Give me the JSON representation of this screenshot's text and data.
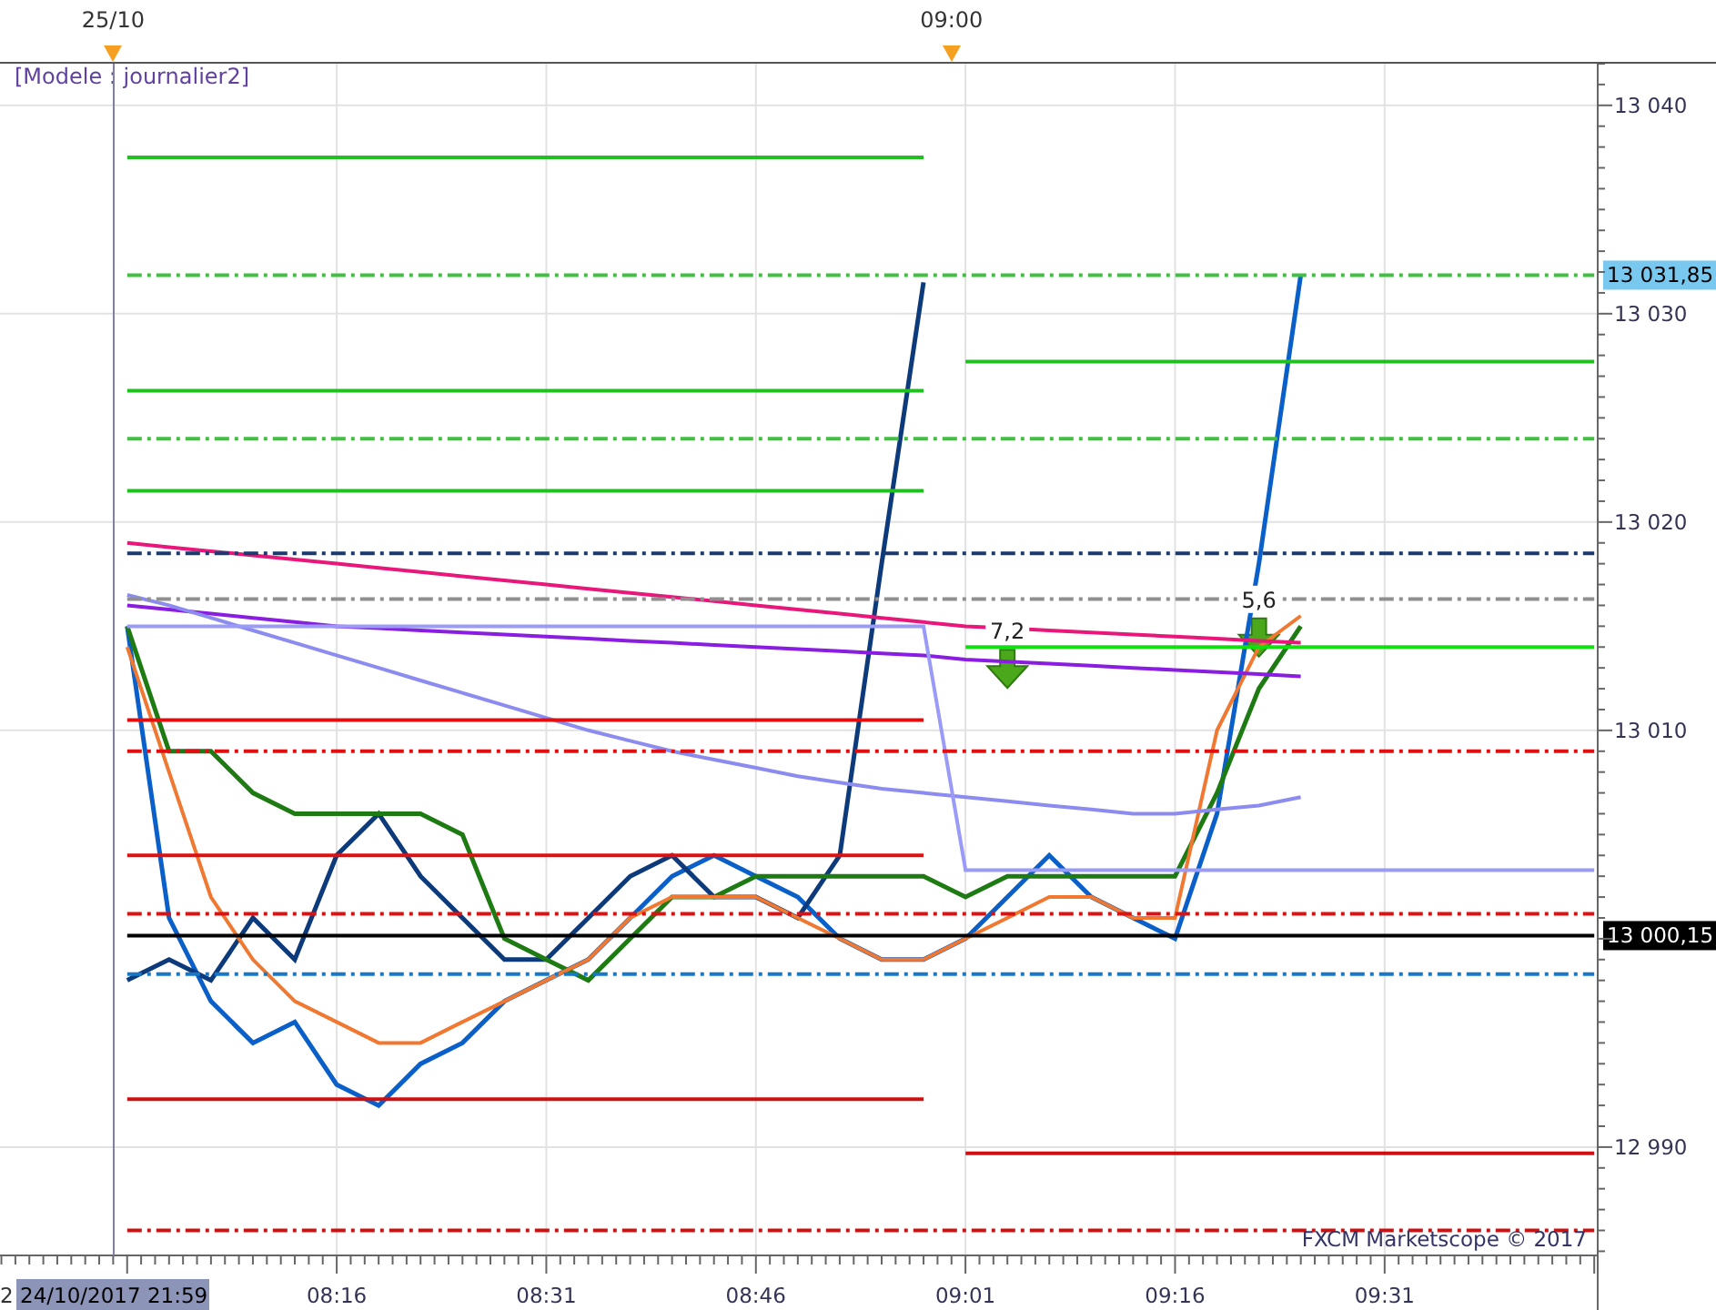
{
  "chart": {
    "time_markers": [
      {
        "label": "25/10"
      },
      {
        "label": "09:00"
      }
    ],
    "model_label": "[Modele : journalier2]",
    "credit": "FXCM Marketscope © 2017",
    "cursor_cut": "2",
    "cursor_label": "24/10/2017 21:59",
    "chart_data": {
      "type": "line",
      "grid": true,
      "xlim": [
        471.9,
        586.25
      ],
      "ylim": [
        12984.8,
        13042
      ],
      "x": [
        481,
        484,
        487,
        490,
        493,
        496,
        499,
        502,
        505,
        508,
        511,
        514,
        517,
        520,
        523,
        526,
        529,
        532,
        535,
        538,
        541,
        544,
        547,
        550,
        553,
        556,
        559,
        562,
        565,
        568,
        571,
        574,
        577,
        580,
        583,
        586
      ],
      "xticks": [
        {
          "value": 496,
          "label": "08:16"
        },
        {
          "value": 511,
          "label": "08:31"
        },
        {
          "value": 526,
          "label": "08:46"
        },
        {
          "value": 541,
          "label": "09:01"
        },
        {
          "value": 556,
          "label": "09:16"
        },
        {
          "value": 571,
          "label": "09:31"
        }
      ],
      "yticks": [
        {
          "value": 12990,
          "label": "12 990"
        },
        {
          "value": 13010,
          "label": "13 010"
        },
        {
          "value": 13020,
          "label": "13 020"
        },
        {
          "value": 13030,
          "label": "13 030"
        },
        {
          "value": 13040,
          "label": "13 040"
        }
      ],
      "series": [
        {
          "color": "#0a5fc8",
          "values": [
            13015,
            13001,
            12997,
            12995,
            12996,
            12993,
            12992,
            12994,
            12995,
            12997,
            12998,
            12999,
            13001,
            13003,
            13004,
            13003,
            13002,
            13000,
            12999,
            12999,
            13000,
            13002,
            13004,
            13002,
            13001,
            13000,
            13006,
            13018,
            13031.85,
            null,
            null,
            null,
            null,
            null,
            null,
            null
          ]
        },
        {
          "color": "#0d3a7a",
          "values": [
            12998,
            12999,
            12998,
            13001,
            12999,
            13004,
            13006,
            13003,
            13001,
            12999,
            12999,
            13001,
            13003,
            13004,
            13002,
            13002,
            13001,
            13004,
            13018,
            13031.5,
            null,
            null,
            null,
            null,
            null,
            null,
            null,
            null,
            null,
            null,
            null,
            null,
            null,
            null,
            null,
            null
          ]
        },
        {
          "color": "#1e7a12",
          "values": [
            13015,
            13009,
            13009,
            13007,
            13006,
            13006,
            13006,
            13006,
            13005,
            13000,
            12999,
            12998,
            13000,
            13002,
            13002,
            13003,
            13003,
            13003,
            13003,
            13003,
            13002,
            13003,
            13003,
            13003,
            13003,
            13003,
            13007,
            13012,
            13015,
            null,
            null,
            null,
            null,
            null,
            null,
            null
          ]
        },
        {
          "color": "#f07830",
          "values": [
            13014,
            13008,
            13002,
            12999,
            12997,
            12996,
            12995,
            12995,
            12996,
            12997,
            12998,
            12999,
            13001,
            13002,
            13002,
            13002,
            13001,
            13000,
            12999,
            12999,
            13000,
            13001,
            13002,
            13002,
            13001,
            13001,
            13010,
            13014,
            13015.5,
            null,
            null,
            null,
            null,
            null,
            null,
            null
          ]
        },
        {
          "color": "#e8187a",
          "values": [
            13019,
            13018.8,
            13018.6,
            13018.4,
            13018.2,
            13018,
            13017.8,
            13017.6,
            13017.4,
            13017.2,
            13017,
            13016.8,
            13016.6,
            13016.4,
            13016.2,
            13016,
            13015.8,
            13015.6,
            13015.4,
            13015.2,
            13015,
            13014.9,
            13014.8,
            13014.7,
            13014.6,
            13014.5,
            13014.4,
            13014.3,
            13014.2,
            null,
            null,
            null,
            null,
            null,
            null,
            null
          ]
        },
        {
          "color": "#8a1ee0",
          "values": [
            13016,
            13015.8,
            13015.6,
            13015.4,
            13015.2,
            13015,
            13014.9,
            13014.8,
            13014.7,
            13014.6,
            13014.5,
            13014.4,
            13014.3,
            13014.2,
            13014.1,
            13014,
            13013.9,
            13013.8,
            13013.7,
            13013.6,
            13013.4,
            13013.3,
            13013.2,
            13013.1,
            13013,
            13012.9,
            13012.8,
            13012.7,
            13012.6,
            null,
            null,
            null,
            null,
            null,
            null,
            null
          ]
        },
        {
          "color": "#8c8cf0",
          "values": [
            13016.5,
            13016,
            13015.4,
            13014.8,
            13014.2,
            13013.6,
            13013,
            13012.4,
            13011.8,
            13011.2,
            13010.6,
            13010,
            13009.5,
            13009,
            13008.6,
            13008.2,
            13007.8,
            13007.5,
            13007.2,
            13007,
            13006.8,
            13006.6,
            13006.4,
            13006.2,
            13006,
            13006,
            13006.2,
            13006.4,
            13006.8,
            null,
            null,
            null,
            null,
            null,
            null,
            null
          ]
        },
        {
          "color": "#9a9af8",
          "values": [
            13015,
            13015,
            13015,
            13015,
            13015,
            13015,
            13015,
            13015,
            13015,
            13015,
            13015,
            13015,
            13015,
            13015,
            13015,
            13015,
            13015,
            13015,
            13015,
            13015,
            13003.3,
            13003.3,
            13003.3,
            13003.3,
            13003.3,
            13003.3,
            13003.3,
            13003.3,
            13003.3,
            13003.3,
            13003.3,
            13003.3,
            13003.3,
            13003.3,
            13003.3,
            13003.3
          ]
        },
        {
          "color": "#20c020",
          "values": [
            13037.5,
            13037.5,
            13037.5,
            13037.5,
            13037.5,
            13037.5,
            13037.5,
            13037.5,
            13037.5,
            13037.5,
            13037.5,
            13037.5,
            13037.5,
            13037.5,
            13037.5,
            13037.5,
            13037.5,
            13037.5,
            13037.5,
            13037.5,
            null,
            null,
            null,
            null,
            null,
            null,
            null,
            null,
            null,
            null,
            null,
            null,
            null,
            null,
            null,
            null
          ]
        },
        {
          "color": "#20c020",
          "values": [
            13026.3,
            13026.3,
            13026.3,
            13026.3,
            13026.3,
            13026.3,
            13026.3,
            13026.3,
            13026.3,
            13026.3,
            13026.3,
            13026.3,
            13026.3,
            13026.3,
            13026.3,
            13026.3,
            13026.3,
            13026.3,
            13026.3,
            13026.3,
            null,
            null,
            null,
            null,
            null,
            null,
            null,
            null,
            null,
            null,
            null,
            null,
            null,
            null,
            null,
            null
          ]
        },
        {
          "color": "#20c020",
          "values": [
            13021.5,
            13021.5,
            13021.5,
            13021.5,
            13021.5,
            13021.5,
            13021.5,
            13021.5,
            13021.5,
            13021.5,
            13021.5,
            13021.5,
            13021.5,
            13021.5,
            13021.5,
            13021.5,
            13021.5,
            13021.5,
            13021.5,
            13021.5,
            null,
            null,
            null,
            null,
            null,
            null,
            null,
            null,
            null,
            null,
            null,
            null,
            null,
            null,
            null,
            null
          ]
        },
        {
          "color": "#e01010",
          "values": [
            13010.5,
            13010.5,
            13010.5,
            13010.5,
            13010.5,
            13010.5,
            13010.5,
            13010.5,
            13010.5,
            13010.5,
            13010.5,
            13010.5,
            13010.5,
            13010.5,
            13010.5,
            13010.5,
            13010.5,
            13010.5,
            13010.5,
            13010.5,
            null,
            null,
            null,
            null,
            null,
            null,
            null,
            null,
            null,
            null,
            null,
            null,
            null,
            null,
            null,
            null
          ]
        },
        {
          "color": "#e01010",
          "values": [
            13004,
            13004,
            13004,
            13004,
            13004,
            13004,
            13004,
            13004,
            13004,
            13004,
            13004,
            13004,
            13004,
            13004,
            13004,
            13004,
            13004,
            13004,
            13004,
            13004,
            null,
            null,
            null,
            null,
            null,
            null,
            null,
            null,
            null,
            null,
            null,
            null,
            null,
            null,
            null,
            null
          ]
        },
        {
          "color": "#d01010",
          "values": [
            12992.3,
            12992.3,
            12992.3,
            12992.3,
            12992.3,
            12992.3,
            12992.3,
            12992.3,
            12992.3,
            12992.3,
            12992.3,
            12992.3,
            12992.3,
            12992.3,
            12992.3,
            12992.3,
            12992.3,
            12992.3,
            12992.3,
            12992.3,
            null,
            null,
            null,
            null,
            null,
            null,
            null,
            null,
            null,
            null,
            null,
            null,
            null,
            null,
            null,
            null
          ]
        },
        {
          "color": "#20c020",
          "values": [
            null,
            null,
            null,
            null,
            null,
            null,
            null,
            null,
            null,
            null,
            null,
            null,
            null,
            null,
            null,
            null,
            null,
            null,
            null,
            null,
            13027.7,
            13027.7,
            13027.7,
            13027.7,
            13027.7,
            13027.7,
            13027.7,
            13027.7,
            13027.7,
            13027.7,
            13027.7,
            13027.7,
            13027.7,
            13027.7,
            13027.7,
            13027.7
          ]
        },
        {
          "color": "#10e010",
          "values": [
            null,
            null,
            null,
            null,
            null,
            null,
            null,
            null,
            null,
            null,
            null,
            null,
            null,
            null,
            null,
            null,
            null,
            null,
            null,
            null,
            13014,
            13014,
            13014,
            13014,
            13014,
            13014,
            13014,
            13014,
            13014,
            13014,
            13014,
            13014,
            13014,
            13014,
            13014,
            13014
          ]
        },
        {
          "color": "#d01010",
          "values": [
            null,
            null,
            null,
            null,
            null,
            null,
            null,
            null,
            null,
            null,
            null,
            null,
            null,
            null,
            null,
            null,
            null,
            null,
            null,
            null,
            12989.7,
            12989.7,
            12989.7,
            12989.7,
            12989.7,
            12989.7,
            12989.7,
            12989.7,
            12989.7,
            12989.7,
            12989.7,
            12989.7,
            12989.7,
            12989.7,
            12989.7,
            12989.7
          ]
        },
        {
          "name": "13 000,15",
          "color": "#000000",
          "values": [
            13000.15,
            13000.15,
            13000.15,
            13000.15,
            13000.15,
            13000.15,
            13000.15,
            13000.15,
            13000.15,
            13000.15,
            13000.15,
            13000.15,
            13000.15,
            13000.15,
            13000.15,
            13000.15,
            13000.15,
            13000.15,
            13000.15,
            13000.15,
            13000.15,
            13000.15,
            13000.15,
            13000.15,
            13000.15,
            13000.15,
            13000.15,
            13000.15,
            13000.15,
            13000.15,
            13000.15,
            13000.15,
            13000.15,
            13000.15,
            13000.15,
            13000.15
          ]
        },
        {
          "name": "13 031,85",
          "color": "#40c040",
          "line_style": "dashed",
          "values": [
            13031.85,
            13031.85,
            13031.85,
            13031.85,
            13031.85,
            13031.85,
            13031.85,
            13031.85,
            13031.85,
            13031.85,
            13031.85,
            13031.85,
            13031.85,
            13031.85,
            13031.85,
            13031.85,
            13031.85,
            13031.85,
            13031.85,
            13031.85,
            13031.85,
            13031.85,
            13031.85,
            13031.85,
            13031.85,
            13031.85,
            13031.85,
            13031.85,
            13031.85,
            13031.85,
            13031.85,
            13031.85,
            13031.85,
            13031.85,
            13031.85,
            13031.85
          ]
        },
        {
          "color": "#40c040",
          "line_style": "dashed",
          "values": [
            13024,
            13024,
            13024,
            13024,
            13024,
            13024,
            13024,
            13024,
            13024,
            13024,
            13024,
            13024,
            13024,
            13024,
            13024,
            13024,
            13024,
            13024,
            13024,
            13024,
            13024,
            13024,
            13024,
            13024,
            13024,
            13024,
            13024,
            13024,
            13024,
            13024,
            13024,
            13024,
            13024,
            13024,
            13024,
            13024
          ]
        },
        {
          "color": "#1a3a70",
          "line_style": "dashed",
          "values": [
            13018.5,
            13018.5,
            13018.5,
            13018.5,
            13018.5,
            13018.5,
            13018.5,
            13018.5,
            13018.5,
            13018.5,
            13018.5,
            13018.5,
            13018.5,
            13018.5,
            13018.5,
            13018.5,
            13018.5,
            13018.5,
            13018.5,
            13018.5,
            13018.5,
            13018.5,
            13018.5,
            13018.5,
            13018.5,
            13018.5,
            13018.5,
            13018.5,
            13018.5,
            13018.5,
            13018.5,
            13018.5,
            13018.5,
            13018.5,
            13018.5,
            13018.5
          ]
        },
        {
          "color": "#909090",
          "line_style": "dashed",
          "values": [
            13016.3,
            13016.3,
            13016.3,
            13016.3,
            13016.3,
            13016.3,
            13016.3,
            13016.3,
            13016.3,
            13016.3,
            13016.3,
            13016.3,
            13016.3,
            13016.3,
            13016.3,
            13016.3,
            13016.3,
            13016.3,
            13016.3,
            13016.3,
            13016.3,
            13016.3,
            13016.3,
            13016.3,
            13016.3,
            13016.3,
            13016.3,
            13016.3,
            13016.3,
            13016.3,
            13016.3,
            13016.3,
            13016.3,
            13016.3,
            13016.3,
            13016.3
          ]
        },
        {
          "color": "#e01010",
          "line_style": "dashed",
          "values": [
            13009,
            13009,
            13009,
            13009,
            13009,
            13009,
            13009,
            13009,
            13009,
            13009,
            13009,
            13009,
            13009,
            13009,
            13009,
            13009,
            13009,
            13009,
            13009,
            13009,
            13009,
            13009,
            13009,
            13009,
            13009,
            13009,
            13009,
            13009,
            13009,
            13009,
            13009,
            13009,
            13009,
            13009,
            13009,
            13009
          ]
        },
        {
          "color": "#e01010",
          "line_style": "dashed",
          "values": [
            13001.2,
            13001.2,
            13001.2,
            13001.2,
            13001.2,
            13001.2,
            13001.2,
            13001.2,
            13001.2,
            13001.2,
            13001.2,
            13001.2,
            13001.2,
            13001.2,
            13001.2,
            13001.2,
            13001.2,
            13001.2,
            13001.2,
            13001.2,
            13001.2,
            13001.2,
            13001.2,
            13001.2,
            13001.2,
            13001.2,
            13001.2,
            13001.2,
            13001.2,
            13001.2,
            13001.2,
            13001.2,
            13001.2,
            13001.2,
            13001.2,
            13001.2
          ]
        },
        {
          "color": "#1878c8",
          "line_style": "dashed",
          "values": [
            12998.3,
            12998.3,
            12998.3,
            12998.3,
            12998.3,
            12998.3,
            12998.3,
            12998.3,
            12998.3,
            12998.3,
            12998.3,
            12998.3,
            12998.3,
            12998.3,
            12998.3,
            12998.3,
            12998.3,
            12998.3,
            12998.3,
            12998.3,
            12998.3,
            12998.3,
            12998.3,
            12998.3,
            12998.3,
            12998.3,
            12998.3,
            12998.3,
            12998.3,
            12998.3,
            12998.3,
            12998.3,
            12998.3,
            12998.3,
            12998.3,
            12998.3
          ]
        },
        {
          "color": "#d01010",
          "line_style": "dashed",
          "values": [
            12986,
            12986,
            12986,
            12986,
            12986,
            12986,
            12986,
            12986,
            12986,
            12986,
            12986,
            12986,
            12986,
            12986,
            12986,
            12986,
            12986,
            12986,
            12986,
            12986,
            12986,
            12986,
            12986,
            12986,
            12986,
            12986,
            12986,
            12986,
            12986,
            12986,
            12986,
            12986,
            12986,
            12986,
            12986,
            12986
          ]
        }
      ],
      "annotations": [
        {
          "x": 544,
          "y": 13013,
          "text": "7,2"
        },
        {
          "x": 562,
          "y": 13014.5,
          "text": "5,6"
        }
      ]
    }
  }
}
